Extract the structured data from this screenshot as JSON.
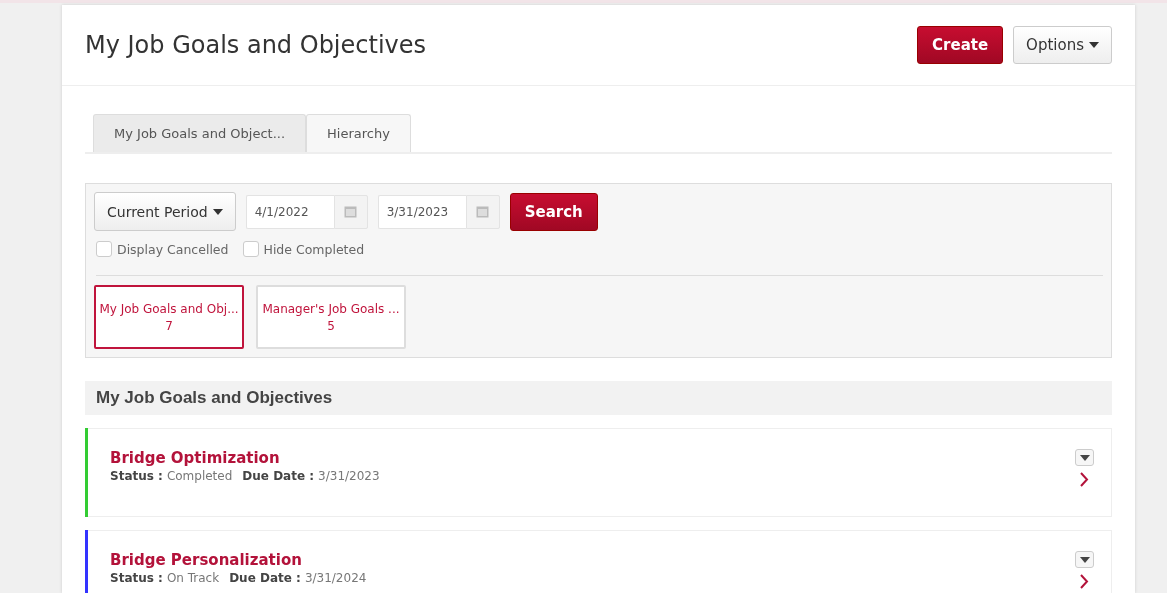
{
  "header": {
    "title": "My Job Goals and Objectives",
    "create_button": "Create",
    "options_button": "Options"
  },
  "tabs": [
    {
      "label": "My Job Goals and Object...",
      "selected": true
    },
    {
      "label": "Hierarchy",
      "selected": false
    }
  ],
  "filters": {
    "period": "Current Period",
    "start_date": "4/1/2022",
    "end_date": "3/31/2023",
    "search_button": "Search",
    "checkboxes": [
      {
        "label": "Display Cancelled",
        "checked": false
      },
      {
        "label": "Hide Completed",
        "checked": false
      }
    ],
    "tiles": [
      {
        "label": "My Job Goals and Obj...",
        "count": "7",
        "selected": true
      },
      {
        "label": "Manager's Job Goals ...",
        "count": "5",
        "selected": false
      }
    ]
  },
  "section": {
    "title": "My Job Goals and Objectives"
  },
  "goals": [
    {
      "title": "Bridge Optimization",
      "status_label": "Status :",
      "status": "Completed",
      "due_label": "Due Date :",
      "due": "3/31/2023",
      "color": "#33cc33"
    },
    {
      "title": "Bridge Personalization",
      "status_label": "Status :",
      "status": "On Track",
      "due_label": "Due Date :",
      "due": "3/31/2024",
      "color": "#3333ff"
    }
  ]
}
